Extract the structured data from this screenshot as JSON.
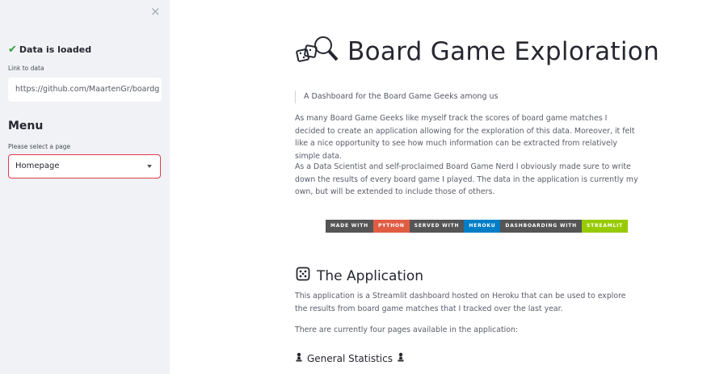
{
  "sidebar": {
    "close_glyph": "×",
    "status_text": "Data is loaded",
    "link_label": "Link to data",
    "link_value": "https://github.com/MaartenGr/boardg",
    "menu_title": "Menu",
    "select_label": "Please select a page",
    "select_value": "Homepage"
  },
  "main": {
    "title": "Board Game Exploration",
    "quote": "A Dashboard for the Board Game Geeks among us",
    "para1": "As many Board Game Geeks like myself track the scores of board game matches I decided to create an application allowing for the exploration of this data. Moreover, it felt like a nice opportunity to see how much information can be extracted from relatively simple data.",
    "para2": "As a Data Scientist and self-proclaimed Board Game Nerd I obviously made sure to write down the results of every board game I played. The data in the application is currently my own, but will be extended to include those of others.",
    "badges": [
      "MADE WITH",
      "PYTHON",
      "SERVED WITH",
      "HEROKU",
      "DASHBOARDING WITH",
      "STREAMLIT"
    ],
    "section_title": "The Application",
    "para3": "This application is a Streamlit dashboard hosted on Heroku that can be used to explore the results from board game matches that I tracked over the last year.",
    "para4": "There are currently four pages available in the application:",
    "subsection_title": "General Statistics"
  },
  "colors": {
    "accent": "#e63946",
    "sidebar_bg": "#f0f2f6",
    "success": "#2e9e3f",
    "python_badge": "#e05d44",
    "heroku_badge": "#007ec6",
    "streamlit_badge": "#97ca00"
  },
  "icons": [
    "close-icon",
    "checkmark-icon",
    "dropdown-caret-icon",
    "magnifier-dice-icon",
    "die-icon",
    "pawn-icon"
  ]
}
